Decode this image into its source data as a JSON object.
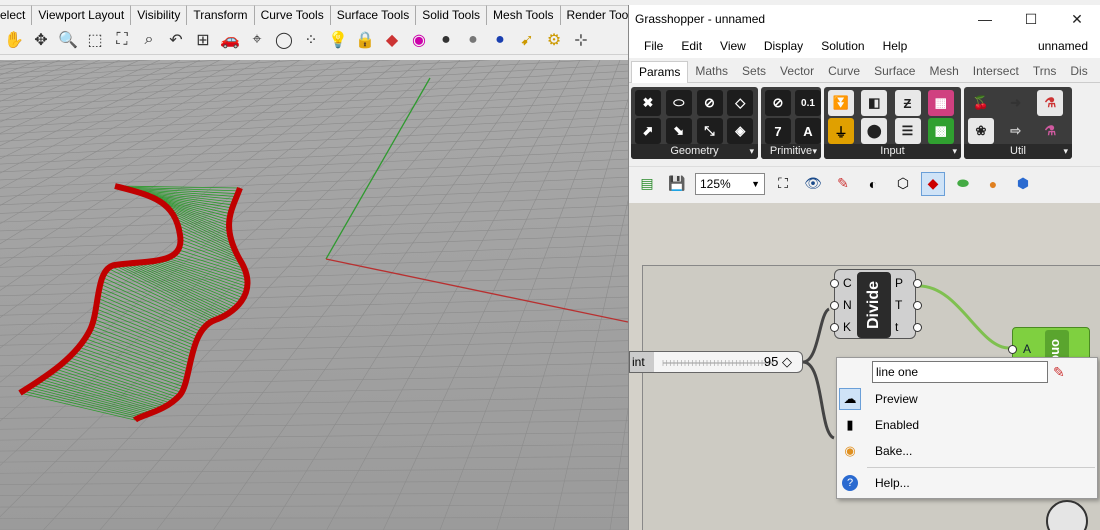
{
  "rhino": {
    "tabs": [
      "elect",
      "Viewport Layout",
      "Visibility",
      "Transform",
      "Curve Tools",
      "Surface Tools",
      "Solid Tools",
      "Mesh Tools",
      "Render Tools"
    ],
    "toolbar_icons": [
      "pan-icon",
      "rotate-view-icon",
      "zoom-icon",
      "zoom-window-icon",
      "zoom-extents-icon",
      "zoom-selected-icon",
      "undo-view-icon",
      "four-viewports-icon",
      "car-icon",
      "camera-icon",
      "circle-icon",
      "points-icon",
      "light-icon",
      "lock-icon",
      "layers-icon",
      "color-wheel-icon",
      "sphere-shaded-icon",
      "sphere-rendered-icon",
      "sphere-blue-icon",
      "select-icon",
      "gear-icon",
      "gumball-icon"
    ]
  },
  "gh": {
    "title": "Grasshopper - unnamed",
    "window_buttons": {
      "minimize": "—",
      "maximize": "☐",
      "close": "✕"
    },
    "menu": [
      "File",
      "Edit",
      "View",
      "Display",
      "Solution",
      "Help"
    ],
    "doc_name": "unnamed",
    "tabs": [
      "Params",
      "Maths",
      "Sets",
      "Vector",
      "Curve",
      "Surface",
      "Mesh",
      "Intersect",
      "Trns",
      "Dis"
    ],
    "active_tab": 0,
    "panels": [
      {
        "label": "Geometry",
        "icons": [
          "✖",
          "⬭",
          "⊘",
          "◇",
          "⬈",
          "⬊",
          "⤡",
          "◈"
        ]
      },
      {
        "label": "Primitive",
        "icons": [
          "⊘",
          "0.1",
          "7",
          "A"
        ]
      },
      {
        "label": "Input",
        "icons": [
          "⏬",
          "◧",
          "Ƶ",
          "▦",
          "⏚",
          "⬤",
          "☰",
          "▩"
        ]
      },
      {
        "label": "Util",
        "icons": [
          "🍒",
          "➜",
          "⚗",
          "❀",
          "⇨",
          "⚗"
        ]
      }
    ],
    "zoom": "125%",
    "canvas": {
      "divide": {
        "title": "Divide",
        "inputs": [
          "C",
          "N",
          "K"
        ],
        "outputs": [
          "P",
          "T",
          "t"
        ]
      },
      "slider": {
        "name": "int",
        "value": "95 ◇"
      },
      "panel": {
        "input": "A",
        "title": "one"
      }
    },
    "context_menu": {
      "input_value": "line one",
      "items": [
        "Preview",
        "Enabled",
        "Bake...",
        "Help..."
      ]
    }
  }
}
